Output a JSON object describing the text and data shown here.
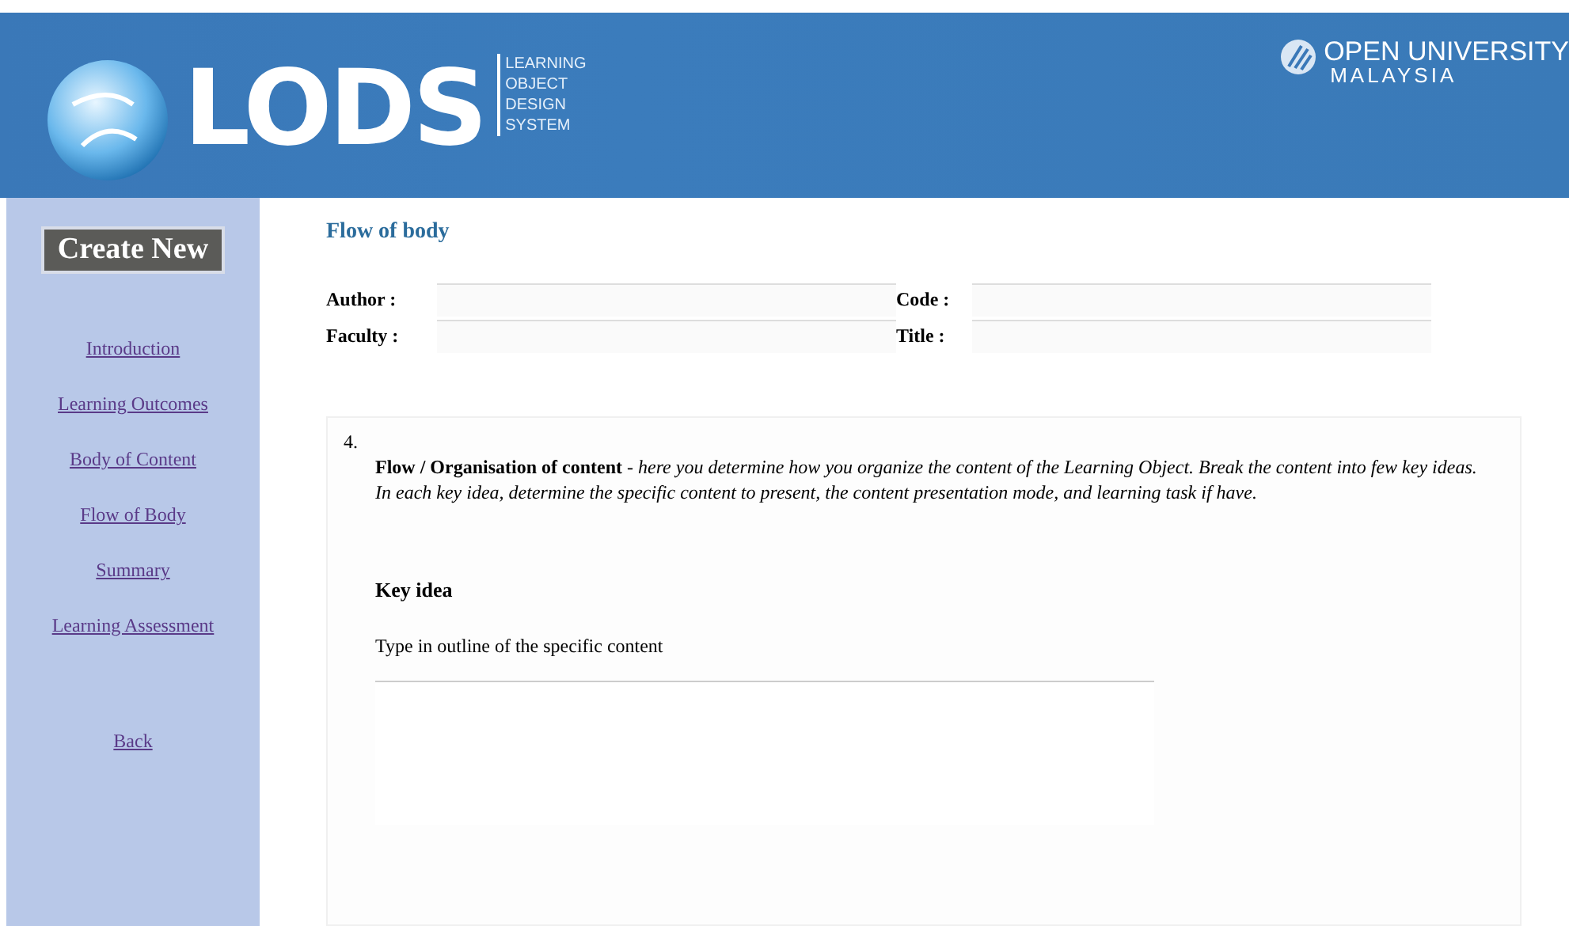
{
  "header": {
    "logo_text": "LODS",
    "logo_subtitle": [
      "LEARNING",
      "OBJECT",
      "DESIGN",
      "SYSTEM"
    ],
    "university": [
      "OPEN UNIVERSITY",
      "MALAYSIA"
    ]
  },
  "sidebar": {
    "button": "Create New",
    "items": [
      {
        "label": "Introduction"
      },
      {
        "label": "Learning Outcomes"
      },
      {
        "label": "Body of Content"
      },
      {
        "label": "Flow of Body"
      },
      {
        "label": "Summary"
      },
      {
        "label": "Learning Assessment"
      }
    ],
    "back": "Back"
  },
  "page_title": "Flow of body",
  "fields": [
    {
      "label": "Author  :"
    },
    {
      "label": "Code :"
    },
    {
      "label": "Faculty :"
    },
    {
      "label": "Title  :"
    }
  ],
  "section": {
    "number": "4.",
    "description": [
      "**Flow / Organisation of content** - *here you determine how you organize the content of the Learning Object. Break the content into few key ideas.*",
      "*In each key idea, determine the specific content to present, the content presentation mode, and learning task if have.*"
    ],
    "heading": "Key idea",
    "prompt": "Type in outline of the specific content"
  }
}
